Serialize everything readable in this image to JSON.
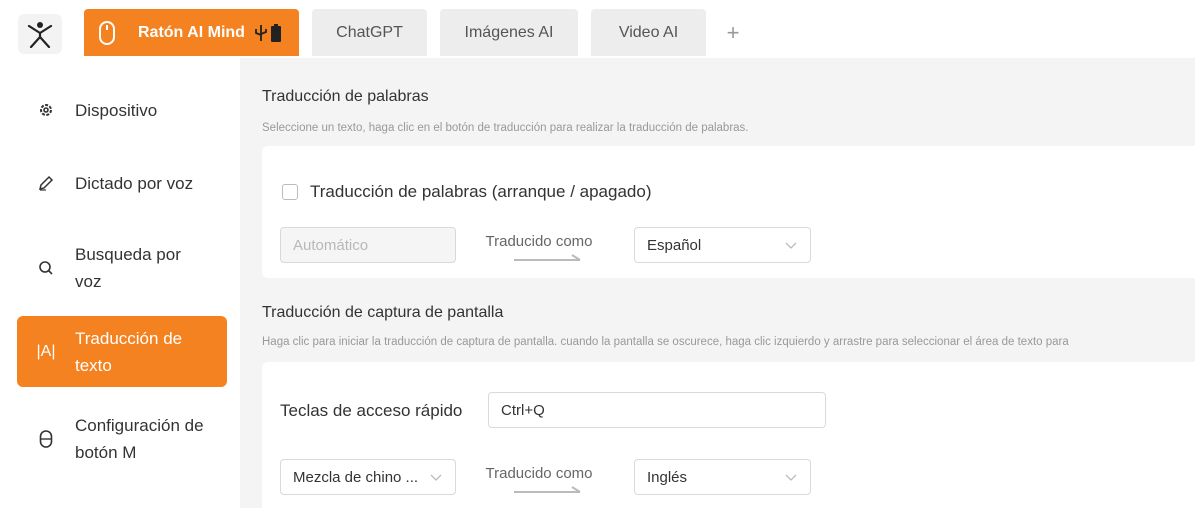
{
  "tabs": {
    "active": "Ratón AI Mind",
    "chatgpt": "ChatGPT",
    "imagenes": "Imágenes AI",
    "video": "Video AI",
    "add": "+"
  },
  "icons": {
    "logo": "stick-figure-icon",
    "mouse": "mouse-icon",
    "usb": "usb-icon",
    "battery": "battery-icon"
  },
  "sidebar": {
    "items": [
      {
        "label": "Dispositivo",
        "icon": "gear-icon"
      },
      {
        "label": "Dictado por voz",
        "icon": "pen-icon"
      },
      {
        "label": "Busqueda por voz",
        "icon": "search-icon"
      },
      {
        "label": "Traducción de texto",
        "icon": "text-translate-icon",
        "glyph": "|A|"
      },
      {
        "label": "Configuración de botón M",
        "icon": "mouse-button-icon"
      }
    ]
  },
  "word_translation": {
    "title": "Traducción de palabras",
    "description": "Seleccione un texto, haga clic en el botón de traducción para realizar la traducción de palabras.",
    "checkbox_label": "Traducción de palabras (arranque / apagado)",
    "source_value": "Automático",
    "translated_as": "Traducido como",
    "target_value": "Español"
  },
  "screen_translation": {
    "title": "Traducción de captura de pantalla",
    "description": "Haga clic para iniciar la traducción de captura de pantalla. cuando la pantalla se oscurece, haga clic izquierdo y arrastre para seleccionar el área de texto para",
    "hotkey_label": "Teclas de acceso rápido",
    "hotkey_value": "Ctrl+Q",
    "source_value": "Mezcla de chino ...",
    "translated_as": "Traducido como",
    "target_value": "Inglés"
  },
  "colors": {
    "accent": "#f58220",
    "background": "#f4f4f4"
  }
}
